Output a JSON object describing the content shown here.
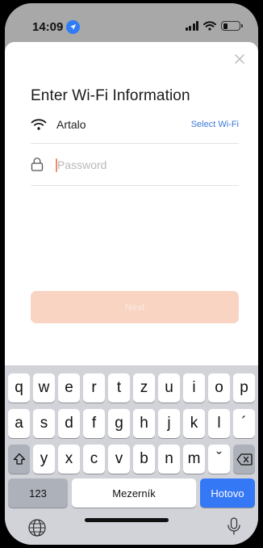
{
  "status_bar": {
    "time": "14:09",
    "location_icon": "location-arrow-icon",
    "signal_icon": "cellular-signal-icon",
    "wifi_icon": "wifi-icon",
    "battery_icon": "battery-icon",
    "battery_level": 0.3
  },
  "sheet": {
    "close_icon": "close-icon",
    "title": "Enter Wi-Fi Information",
    "wifi": {
      "icon": "wifi-icon",
      "network_name": "Artalo",
      "select_label": "Select Wi-Fi"
    },
    "password": {
      "icon": "lock-icon",
      "placeholder": "Password",
      "value": ""
    },
    "next_label": "Next"
  },
  "keyboard": {
    "row1": [
      "q",
      "w",
      "e",
      "r",
      "t",
      "z",
      "u",
      "i",
      "o",
      "p"
    ],
    "row2": [
      "a",
      "s",
      "d",
      "f",
      "g",
      "h",
      "j",
      "k",
      "l",
      "´"
    ],
    "row3": [
      "y",
      "x",
      "c",
      "v",
      "b",
      "n",
      "m",
      "ˇ"
    ],
    "shift_icon": "shift-icon",
    "backspace_icon": "backspace-icon",
    "numbers_label": "123",
    "space_label": "Mezerník",
    "done_label": "Hotovo",
    "globe_icon": "globe-icon",
    "mic_icon": "microphone-icon"
  },
  "colors": {
    "accent_blue": "#3478f6",
    "next_button": "#f9d4c3",
    "select_wifi_link": "#3a78d8",
    "caret": "#f08a6e"
  }
}
